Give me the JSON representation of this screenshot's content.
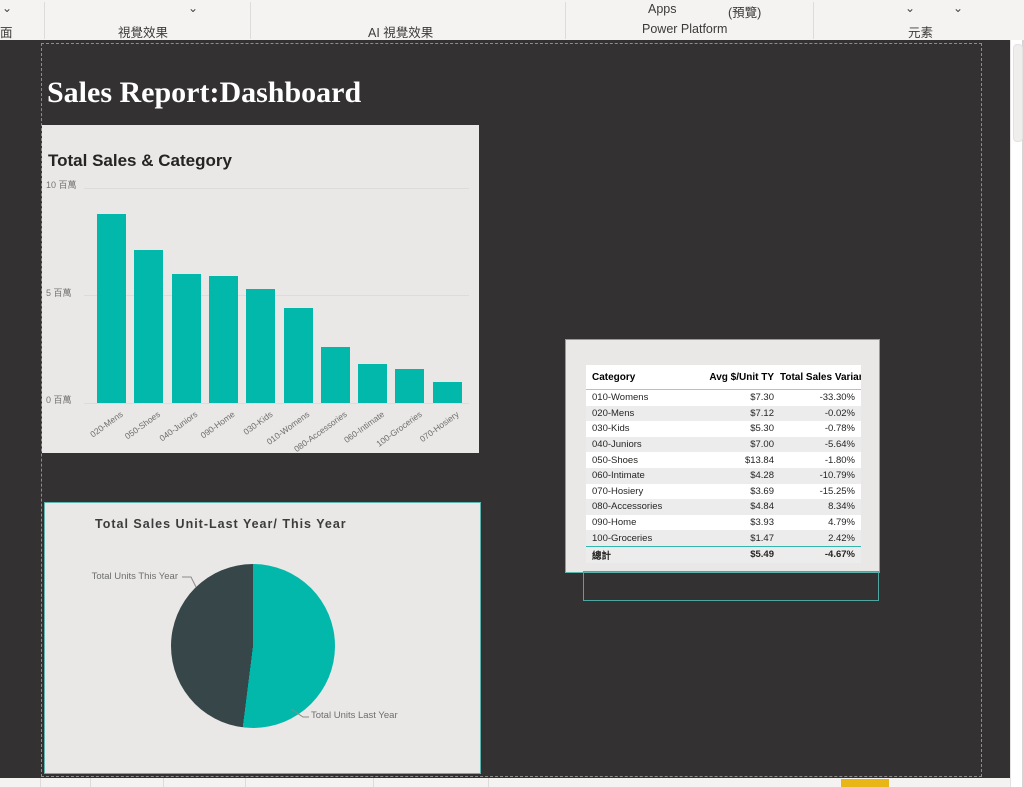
{
  "ribbon": {
    "chevron": "⌄",
    "groups": {
      "page": {
        "label": "面"
      },
      "visuals": {
        "label": "視覺效果"
      },
      "ai_visuals": {
        "label": "AI 視覺效果"
      },
      "power_platform": {
        "label": "Power Platform",
        "apps_label": "Apps",
        "preview_label": "(預覽)"
      },
      "elements": {
        "label": "元素"
      }
    }
  },
  "page": {
    "title": "Sales Report:Dashboard"
  },
  "colors": {
    "teal": "#01B8AA",
    "dark_slate": "#374649",
    "canvas": "#333132",
    "card": "#e9e8e6",
    "selection_border": "#5fb3ad",
    "accent_yellow": "#e8b616"
  },
  "chart_data": [
    {
      "type": "bar",
      "title": "Total Sales & Category",
      "categories": [
        "020-Mens",
        "050-Shoes",
        "040-Juniors",
        "090-Home",
        "030-Kids",
        "010-Womens",
        "080-Accessories",
        "060-Intimate",
        "100-Groceries",
        "070-Hosiery"
      ],
      "values": [
        8.8,
        7.1,
        6.0,
        5.9,
        5.3,
        4.4,
        2.6,
        1.8,
        1.6,
        1.0
      ],
      "unit": "百萬",
      "y_ticks": [
        "10 百萬",
        "5 百萬",
        "0 百萬"
      ],
      "ylim": [
        0,
        10
      ],
      "xlabel": "",
      "ylabel": "",
      "grid": true,
      "legend": "none",
      "bar_color": "#01B8AA"
    },
    {
      "type": "pie",
      "title": "Total Sales Unit-Last Year/ This Year",
      "slices": [
        {
          "label": "Total Units Last Year",
          "value": 52,
          "color": "#01B8AA"
        },
        {
          "label": "Total Units This Year",
          "value": 48,
          "color": "#374649"
        }
      ],
      "legend": "callout-labels"
    },
    {
      "type": "table",
      "columns": [
        "Category",
        "Avg $/Unit TY",
        "Total Sales Variance %"
      ],
      "rows": [
        [
          "010-Womens",
          "$7.30",
          "-33.30%"
        ],
        [
          "020-Mens",
          "$7.12",
          "-0.02%"
        ],
        [
          "030-Kids",
          "$5.30",
          "-0.78%"
        ],
        [
          "040-Juniors",
          "$7.00",
          "-5.64%"
        ],
        [
          "050-Shoes",
          "$13.84",
          "-1.80%"
        ],
        [
          "060-Intimate",
          "$4.28",
          "-10.79%"
        ],
        [
          "070-Hosiery",
          "$3.69",
          "-15.25%"
        ],
        [
          "080-Accessories",
          "$4.84",
          "8.34%"
        ],
        [
          "090-Home",
          "$3.93",
          "4.79%"
        ],
        [
          "100-Groceries",
          "$1.47",
          "2.42%"
        ]
      ],
      "total_row": [
        "總計",
        "$5.49",
        "-4.67%"
      ]
    }
  ]
}
